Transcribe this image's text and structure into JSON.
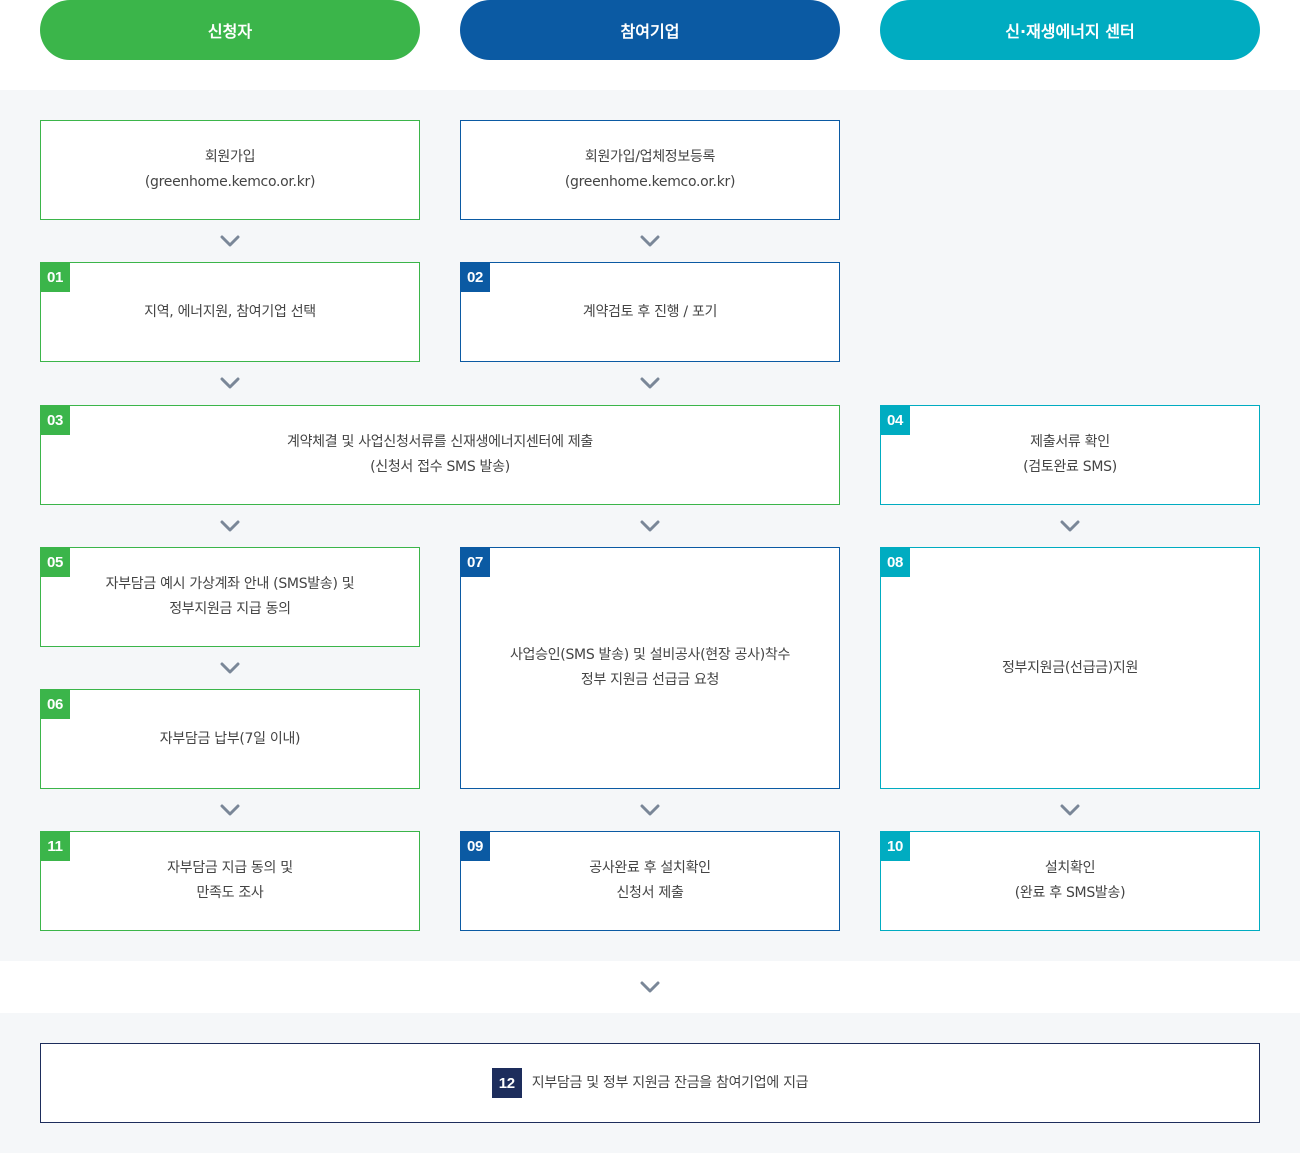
{
  "colors": {
    "applicant": "#3bb54a",
    "company": "#0b5aa3",
    "center": "#00acc1",
    "final": "#1d2d5c",
    "band": "#f5f7f9",
    "chevron": "#7a8798"
  },
  "columns": {
    "applicant": "신청자",
    "company": "참여기업",
    "center": "신·재생에너지 센터"
  },
  "signup": {
    "applicant": [
      "회원가입",
      "(greenhome.kemco.or.kr)"
    ],
    "company": [
      "회원가입/업체정보등록",
      "(greenhome.kemco.or.kr)"
    ]
  },
  "steps": {
    "s01": {
      "num": "01",
      "lines": [
        "지역, 에너지원, 참여기업 선택"
      ]
    },
    "s02": {
      "num": "02",
      "lines": [
        "계약검토 후 진행 / 포기"
      ]
    },
    "s03": {
      "num": "03",
      "lines": [
        "계약체결 및 사업신청서류를 신재생에너지센터에 제출",
        "(신청서 접수 SMS 발송)"
      ]
    },
    "s04": {
      "num": "04",
      "lines": [
        "제출서류 확인",
        "(검토완료 SMS)"
      ]
    },
    "s05": {
      "num": "05",
      "lines": [
        "자부담금 예시 가상계좌 안내 (SMS발송) 및",
        "정부지원금 지급 동의"
      ]
    },
    "s06": {
      "num": "06",
      "lines": [
        "자부담금 납부(7일 이내)"
      ]
    },
    "s07": {
      "num": "07",
      "lines": [
        "사업승인(SMS 발송) 및 설비공사(현장 공사)착수",
        "정부 지원금 선급금 요청"
      ]
    },
    "s08": {
      "num": "08",
      "lines": [
        "정부지원금(선급금)지원"
      ]
    },
    "s09": {
      "num": "09",
      "lines": [
        "공사완료 후 설치확인",
        "신청서 제출"
      ]
    },
    "s10": {
      "num": "10",
      "lines": [
        "설치확인",
        "(완료 후 SMS발송)"
      ]
    },
    "s11": {
      "num": "11",
      "lines": [
        "자부담금 지급 동의 및",
        "만족도 조사"
      ]
    },
    "s12": {
      "num": "12",
      "lines": [
        "지부담금 및 정부 지원금 잔금을 참여기업에 지급"
      ]
    }
  }
}
